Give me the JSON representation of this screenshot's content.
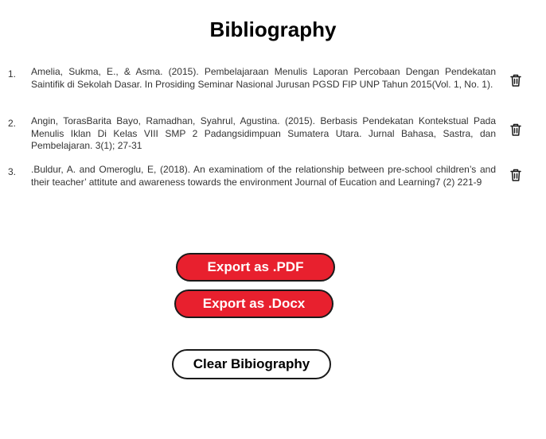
{
  "page": {
    "title": "Bibliography"
  },
  "references": [
    {
      "number": "1.",
      "text": "Amelia, Sukma, E., & Asma. (2015). Pembelajaraan Menulis Laporan Percobaan Dengan Pendekatan Saintifik di Sekolah Dasar. In Prosiding Seminar Nasional Jurusan PGSD FIP UNP Tahun 2015(Vol. 1, No. 1).",
      "icon": "trash-icon"
    },
    {
      "number": "2.",
      "text": "Angin, TorasBarita Bayo, Ramadhan, Syahrul, Agustina. (2015). Berbasis Pendekatan Kontekstual Pada Menulis Iklan Di Kelas VIII SMP 2 Padangsidimpuan Sumatera Utara. Jurnal Bahasa, Sastra, dan Pembelajaran. 3(1); 27-31",
      "icon": "trash-icon"
    },
    {
      "number": "3.",
      "text": ".Buldur, A. and Omeroglu, E, (2018). An examinatiom of the relationship between pre-school children’s and their teacher’ attitute and awareness towards the environment Journal of Eucation and Learning7 (2) 221-9",
      "icon": "trash-icon"
    }
  ],
  "actions": {
    "export_pdf_label": "Export as .PDF",
    "export_docx_label": "Export as .Docx",
    "clear_label": "Clear Bibiography"
  },
  "colors": {
    "accent": "#e8202e",
    "text": "#333333",
    "border": "#1a1a1a"
  }
}
